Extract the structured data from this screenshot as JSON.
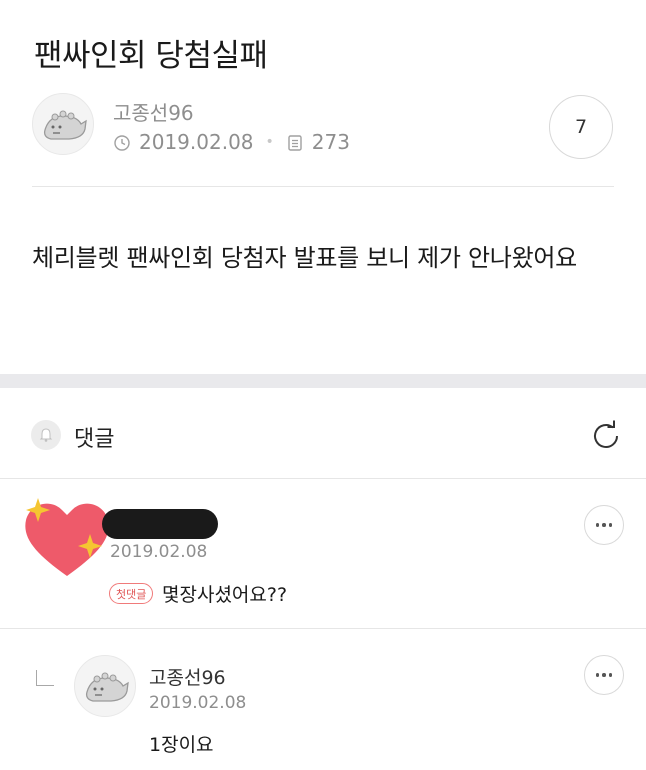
{
  "post": {
    "title": "팬싸인회 당첨실패",
    "author": "고종선96",
    "date": "2019.02.08",
    "views": "273",
    "comment_count": "7",
    "body": "체리블렛 팬싸인회 당첨자 발표를 보니 제가 안나왔어요"
  },
  "comments_section": {
    "label": "댓글"
  },
  "comments": [
    {
      "date": "2019.02.08",
      "badge": "첫댓글",
      "text": "몇장사셨어요??"
    }
  ],
  "replies": [
    {
      "author": "고종선96",
      "date": "2019.02.08",
      "text": "1장이요"
    }
  ],
  "icons": {
    "clock": "clock-icon",
    "views": "document-icon",
    "bell": "bell-icon",
    "refresh": "refresh-icon",
    "more": "more-icon",
    "reply": "reply-arrow-icon"
  },
  "colors": {
    "heart": "#ee5a6a",
    "sparkle": "#f5c531",
    "badge": "#e05555"
  }
}
